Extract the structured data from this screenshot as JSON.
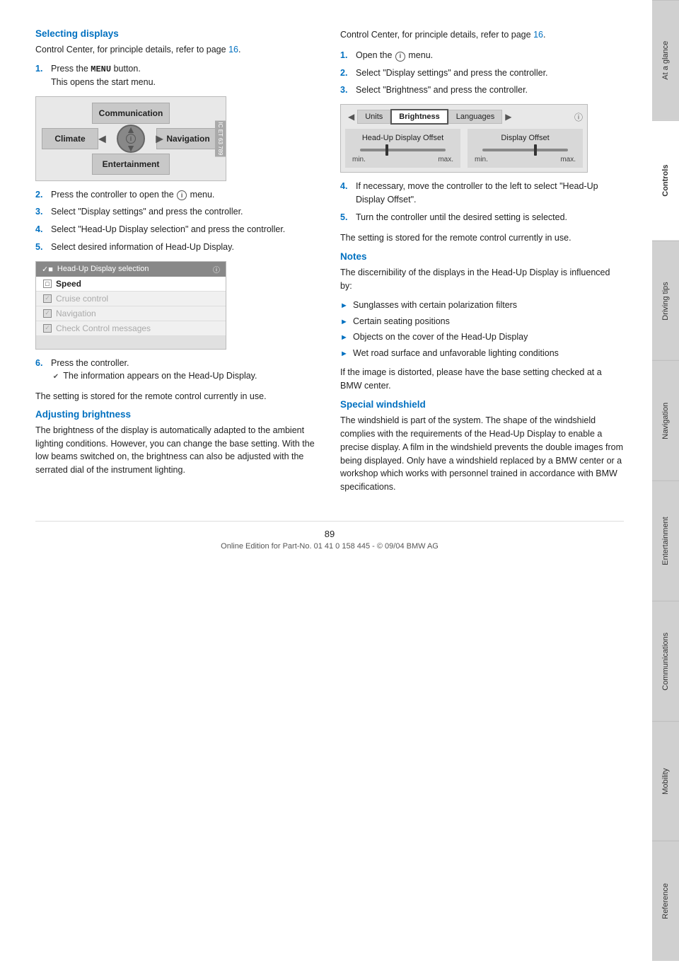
{
  "sidebar": {
    "tabs": [
      {
        "label": "At a glance",
        "active": false
      },
      {
        "label": "Controls",
        "active": true
      },
      {
        "label": "Driving tips",
        "active": false
      },
      {
        "label": "Navigation",
        "active": false
      },
      {
        "label": "Entertainment",
        "active": false
      },
      {
        "label": "Communications",
        "active": false
      },
      {
        "label": "Mobility",
        "active": false
      },
      {
        "label": "Reference",
        "active": false
      }
    ]
  },
  "left_column": {
    "section1_heading": "Selecting displays",
    "section1_intro": "Control Center, for principle details, refer to page",
    "section1_page_ref": "16",
    "steps": [
      {
        "num": "1.",
        "text_before": "Press the ",
        "bold": "MENU",
        "text_after": " button.\nThis opens the start menu."
      },
      {
        "num": "2.",
        "text": "Press the controller to open the",
        "icon": "i",
        "text_after": "menu."
      },
      {
        "num": "3.",
        "text": "Select \"Display settings\" and press the controller."
      },
      {
        "num": "4.",
        "text": "Select \"Head-Up Display selection\" and press the controller."
      },
      {
        "num": "5.",
        "text": "Select desired information of Head-Up Display."
      },
      {
        "num": "6.",
        "text_before": "Press the controller.\n",
        "checkmark": "✔",
        "text_after": " The information appears on the Head-Up Display."
      }
    ],
    "setting_stored_1": "The setting is stored for the remote control currently in use.",
    "nav_diagram": {
      "communication": "Communication",
      "climate": "Climate",
      "navigation": "Navigation",
      "entertainment": "Entertainment"
    },
    "hud_selection": {
      "title": "Head-Up Display selection",
      "items": [
        {
          "label": "Speed",
          "checked": false,
          "selected": true
        },
        {
          "label": "Cruise control",
          "checked": true,
          "grayed": true
        },
        {
          "label": "Navigation",
          "checked": true,
          "grayed": true
        },
        {
          "label": "Check Control messages",
          "checked": true,
          "grayed": true
        }
      ]
    },
    "section2_heading": "Adjusting brightness",
    "section2_text": "The brightness of the display is automatically adapted to the ambient lighting conditions. However, you can change the base setting. With the low beams switched on, the brightness can also be adjusted with the serrated dial of the instrument lighting."
  },
  "right_column": {
    "intro": "Control Center, for principle details, refer to page",
    "page_ref": "16",
    "steps": [
      {
        "num": "1.",
        "text": "Open the",
        "icon": "i",
        "text_after": "menu."
      },
      {
        "num": "2.",
        "text": "Select \"Display settings\" and press the controller."
      },
      {
        "num": "3.",
        "text": "Select \"Brightness\" and press the controller."
      },
      {
        "num": "4.",
        "text": "If necessary, move the controller to the left to select \"Head-Up Display Offset\"."
      },
      {
        "num": "5.",
        "text": "Turn the controller until the desired setting is selected."
      }
    ],
    "setting_stored_2": "The setting is stored for the remote control currently in use.",
    "brightness_tabs": [
      "Units",
      "Brightness",
      "Languages"
    ],
    "brightness_active_tab": "Brightness",
    "panel1": {
      "title": "Head-Up Display\nOffset",
      "min": "min.",
      "max": "max."
    },
    "panel2": {
      "title": "Display\nOffset",
      "min": "min.",
      "max": "max."
    },
    "notes_heading": "Notes",
    "notes_intro": "The discernibility of the displays in the Head-Up Display is influenced by:",
    "notes_items": [
      "Sunglasses with certain polarization filters",
      "Certain seating positions",
      "Objects on the cover of the Head-Up Display",
      "Wet road surface and unfavorable lighting conditions"
    ],
    "notes_footer": "If the image is distorted, please have the base setting checked at a BMW center.",
    "special_heading": "Special windshield",
    "special_text": "The windshield is part of the system. The shape of the windshield complies with the requirements of the Head-Up Display to enable a precise display. A film in the windshield prevents the double images from being displayed. Only have a windshield replaced by a BMW center or a workshop which works with personnel trained in accordance with BMW specifications."
  },
  "footer": {
    "page_number": "89",
    "copyright": "Online Edition for Part-No. 01 41 0 158 445 - © 09/04 BMW AG"
  }
}
